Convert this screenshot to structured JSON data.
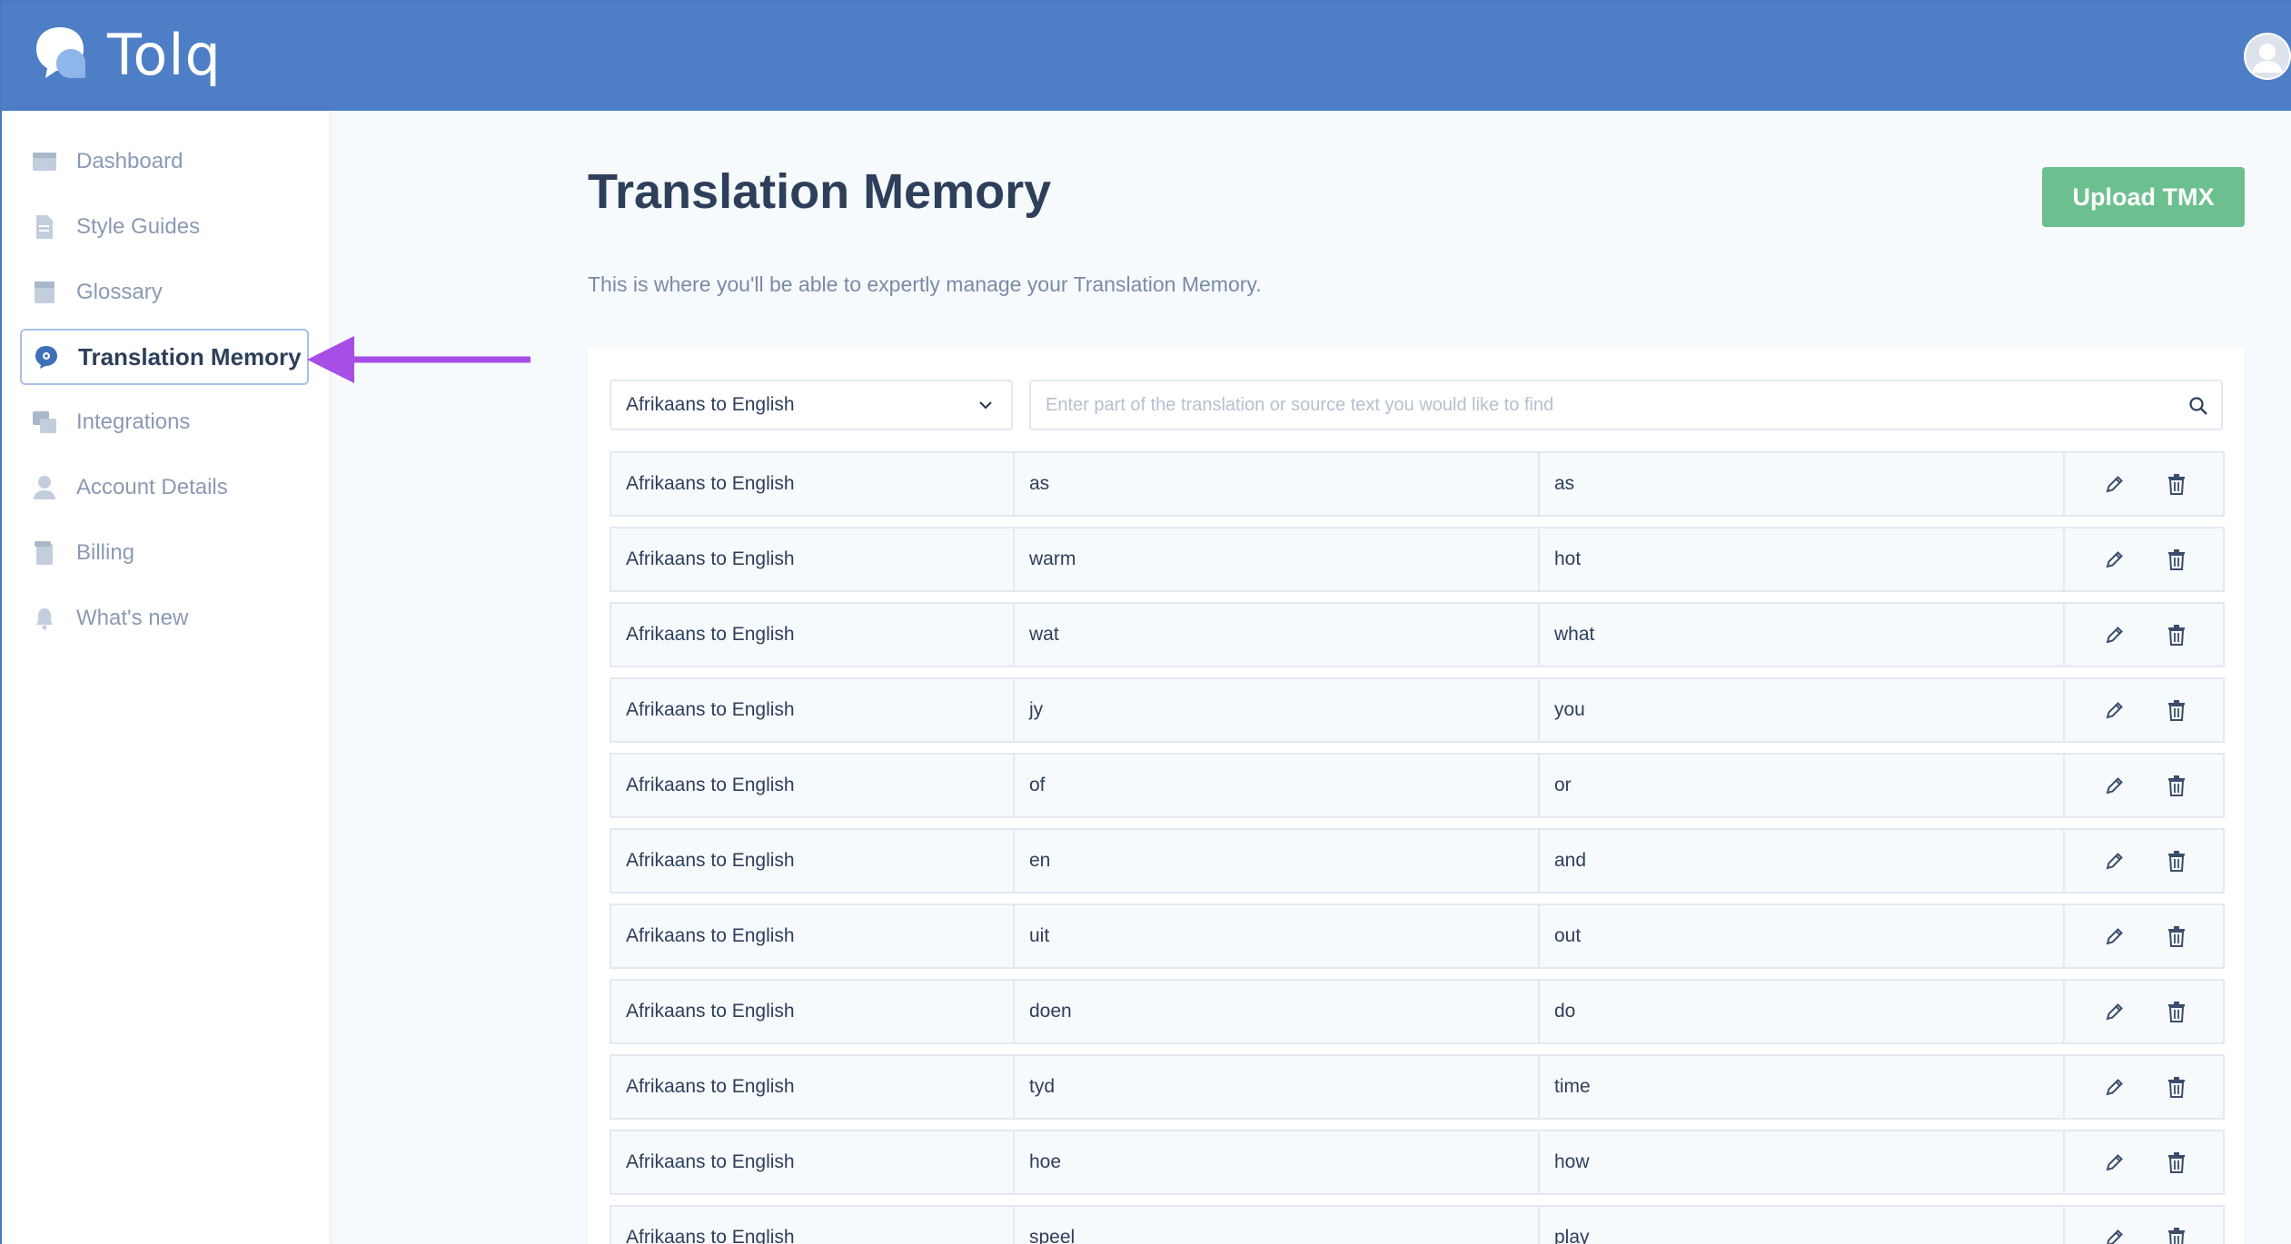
{
  "app": {
    "name": "Tolq"
  },
  "colors": {
    "brand": "#4d7ec6",
    "upload": "#6cc08f",
    "annotation_arrow": "#a64ee6"
  },
  "sidebar": {
    "items": [
      {
        "label": "Dashboard",
        "icon": "dashboard-icon"
      },
      {
        "label": "Style Guides",
        "icon": "document-icon"
      },
      {
        "label": "Glossary",
        "icon": "book-icon"
      },
      {
        "label": "Translation Memory",
        "icon": "memory-icon",
        "active": true
      },
      {
        "label": "Integrations",
        "icon": "integrations-icon"
      },
      {
        "label": "Account Details",
        "icon": "user-icon"
      },
      {
        "label": "Billing",
        "icon": "billing-icon"
      },
      {
        "label": "What's new",
        "icon": "bell-icon"
      }
    ]
  },
  "main": {
    "title": "Translation Memory",
    "subtitle": "This is where you'll be able to expertly manage your Translation Memory.",
    "upload_label": "Upload TMX",
    "language_filter": "Afrikaans to English",
    "search_placeholder": "Enter part of the translation or source text you would like to find",
    "rows": [
      {
        "pair": "Afrikaans to English",
        "source": "as",
        "target": "as"
      },
      {
        "pair": "Afrikaans to English",
        "source": "warm",
        "target": "hot"
      },
      {
        "pair": "Afrikaans to English",
        "source": "wat",
        "target": "what"
      },
      {
        "pair": "Afrikaans to English",
        "source": "jy",
        "target": "you"
      },
      {
        "pair": "Afrikaans to English",
        "source": "of",
        "target": "or"
      },
      {
        "pair": "Afrikaans to English",
        "source": "en",
        "target": "and"
      },
      {
        "pair": "Afrikaans to English",
        "source": "uit",
        "target": "out"
      },
      {
        "pair": "Afrikaans to English",
        "source": "doen",
        "target": "do"
      },
      {
        "pair": "Afrikaans to English",
        "source": "tyd",
        "target": "time"
      },
      {
        "pair": "Afrikaans to English",
        "source": "hoe",
        "target": "how"
      },
      {
        "pair": "Afrikaans to English",
        "source": "speel",
        "target": "play"
      }
    ]
  }
}
